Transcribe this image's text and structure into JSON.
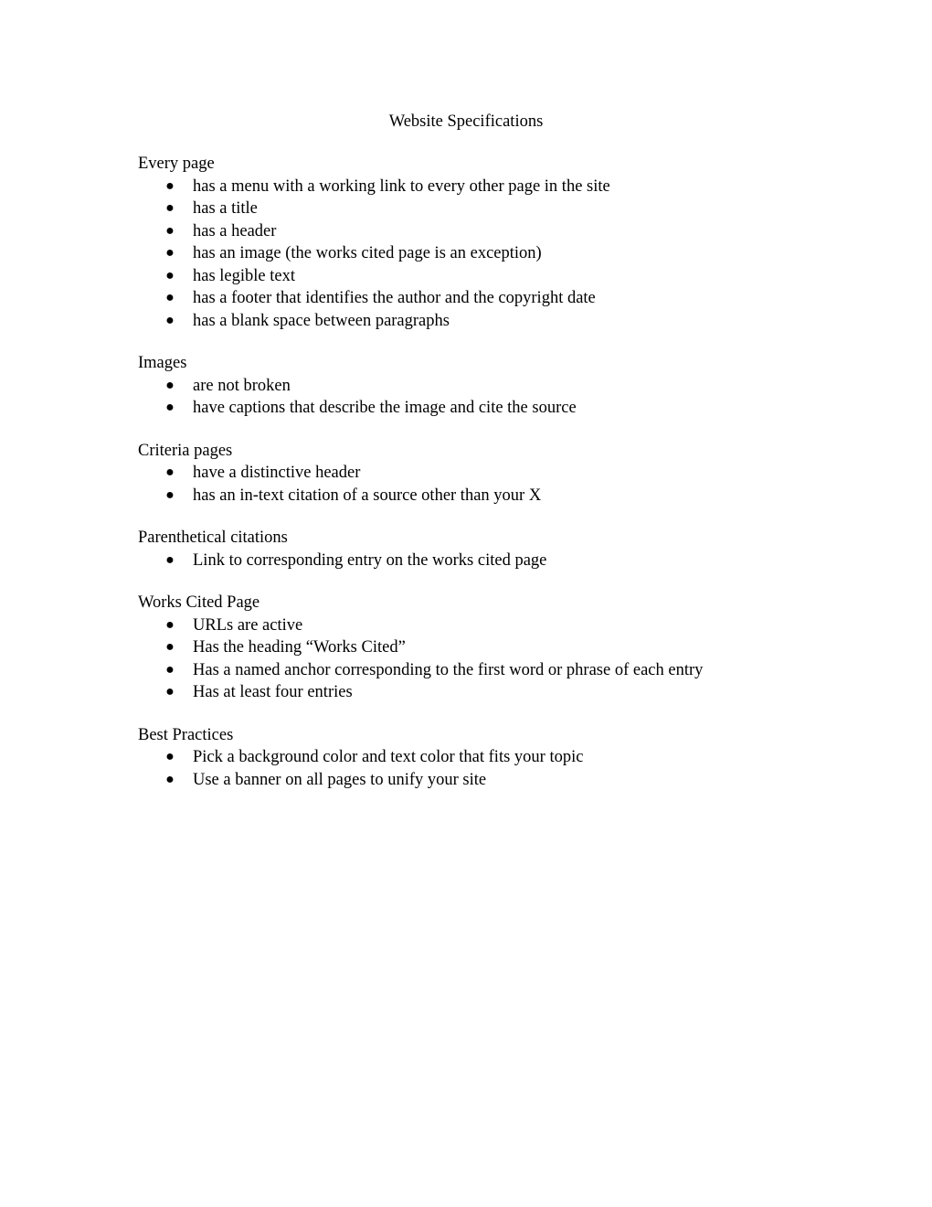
{
  "document": {
    "title": "Website Specifications",
    "sections": [
      {
        "heading": "Every page",
        "items": [
          "has a menu with a working link to every other page in the site",
          "has a title",
          "has a header",
          "has an image (the works cited page is an exception)",
          "has legible text",
          "has a footer that identifies the author and the copyright date",
          "has a blank space between paragraphs"
        ]
      },
      {
        "heading": "Images",
        "items": [
          "are not broken",
          "have captions that describe the image and cite the source"
        ]
      },
      {
        "heading": "Criteria pages",
        "items": [
          "have a distinctive header",
          "has an in-text citation of a source other than your X"
        ]
      },
      {
        "heading": "Parenthetical citations",
        "items": [
          "Link to corresponding entry on the works cited page"
        ]
      },
      {
        "heading": "Works Cited Page",
        "items": [
          "URLs are active",
          "Has the heading “Works Cited”",
          "Has a named anchor corresponding to the first word or phrase of each entry",
          "Has at least four entries"
        ]
      },
      {
        "heading": "Best Practices",
        "items": [
          "Pick a background color and text color that fits your topic",
          "Use a banner on all pages to unify your site"
        ]
      }
    ],
    "bullet_glyph": "●"
  }
}
